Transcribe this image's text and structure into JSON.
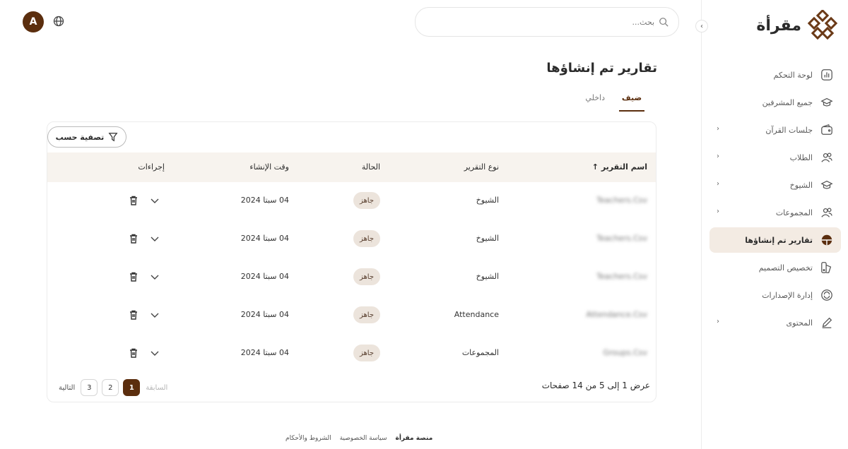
{
  "brand": {
    "name": "مقرأة",
    "accent": "#5b2e0e"
  },
  "search": {
    "placeholder": "بحث..."
  },
  "user": {
    "avatar_letter": "A"
  },
  "sidebar": {
    "items": [
      {
        "label": "لوحة التحكم",
        "icon": "chart-icon",
        "chevron": false
      },
      {
        "label": "جميع المشرفين",
        "icon": "graduation-cap-icon",
        "chevron": false
      },
      {
        "label": "جلسات القرآن",
        "icon": "wallet-icon",
        "chevron": true
      },
      {
        "label": "الطلاب",
        "icon": "users-icon",
        "chevron": true
      },
      {
        "label": "الشيوخ",
        "icon": "graduation-cap-icon",
        "chevron": true
      },
      {
        "label": "المجموعات",
        "icon": "group-icon",
        "chevron": true
      },
      {
        "label": "تقارير تم إنشاؤها",
        "icon": "report-icon",
        "chevron": false,
        "active": true
      },
      {
        "label": "تخصيص التصميم",
        "icon": "design-icon",
        "chevron": false
      },
      {
        "label": "إدارة الإصدارات",
        "icon": "refresh-icon",
        "chevron": false
      },
      {
        "label": "المحتوى",
        "icon": "edit-icon",
        "chevron": true
      }
    ]
  },
  "main": {
    "title": "تقارير تم إنشاؤها",
    "tabs": [
      {
        "label": "ضيف",
        "active": true
      },
      {
        "label": "داخلي",
        "active": false
      }
    ],
    "filter_label": "تصفية حسب",
    "columns": {
      "name": "اسم التقرير",
      "type": "نوع التقرير",
      "status": "الحالة",
      "created": "وقت الإنشاء",
      "actions": "إجراءات"
    },
    "rows": [
      {
        "name": "Teachers.Csv",
        "type": "الشيوخ",
        "status": "جاهز",
        "created": "04 سبتا 2024"
      },
      {
        "name": "Teachers.Csv",
        "type": "الشيوخ",
        "status": "جاهز",
        "created": "04 سبتا 2024"
      },
      {
        "name": "Teachers.Csv",
        "type": "الشيوخ",
        "status": "جاهز",
        "created": "04 سبتا 2024"
      },
      {
        "name": "Attendance.Csv",
        "type": "Attendance",
        "status": "جاهز",
        "created": "04 سبتا 2024"
      },
      {
        "name": "Groups.Csv",
        "type": "المجموعات",
        "status": "جاهز",
        "created": "04 سبتا 2024"
      }
    ],
    "pagination": {
      "info": "عرض 1 إلى 5 من 14 صفحات",
      "prev": "السابقة",
      "next": "التالية",
      "pages": [
        "1",
        "2",
        "3"
      ],
      "current": "1"
    }
  },
  "footer": {
    "platform": "منصة مقرأة",
    "privacy": "سياسة الخصوصية",
    "terms": "الشروط والأحكام"
  }
}
